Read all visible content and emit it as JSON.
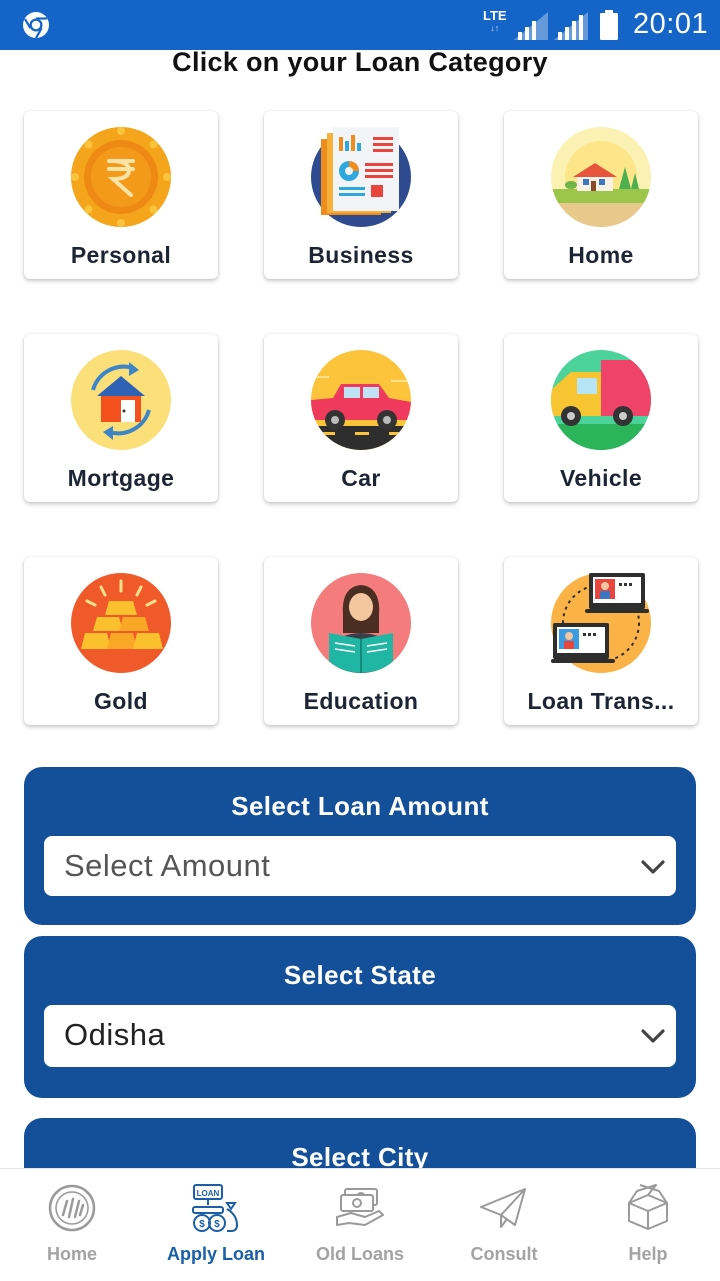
{
  "status_bar": {
    "network": "LTE",
    "time": "20:01"
  },
  "page": {
    "heading": "Click on your Loan Category"
  },
  "categories": [
    {
      "label": "Personal",
      "icon": "rupee-coin-icon"
    },
    {
      "label": "Business",
      "icon": "business-report-icon"
    },
    {
      "label": "Home",
      "icon": "house-icon"
    },
    {
      "label": "Mortgage",
      "icon": "mortgage-house-icon"
    },
    {
      "label": "Car",
      "icon": "car-icon"
    },
    {
      "label": "Vehicle",
      "icon": "truck-icon"
    },
    {
      "label": "Gold",
      "icon": "gold-bars-icon"
    },
    {
      "label": "Education",
      "icon": "student-reading-icon"
    },
    {
      "label": "Loan Trans...",
      "icon": "laptop-transfer-icon"
    }
  ],
  "loan_amount": {
    "title": "Select Loan Amount",
    "value": "Select Amount"
  },
  "state": {
    "title": "Select State",
    "value": "Odisha"
  },
  "city": {
    "title": "Select City"
  },
  "bottom_nav": [
    {
      "label": "Home",
      "icon": "home-coins-icon",
      "active": false
    },
    {
      "label": "Apply Loan",
      "icon": "loan-bag-icon",
      "active": true
    },
    {
      "label": "Old Loans",
      "icon": "money-hand-icon",
      "active": false
    },
    {
      "label": "Consult",
      "icon": "paper-plane-icon",
      "active": false
    },
    {
      "label": "Help",
      "icon": "help-box-icon",
      "active": false
    }
  ],
  "colors": {
    "status_bar": "#1565c8",
    "panel": "#14509a",
    "nav_active": "#1a5fa8",
    "nav_inactive": "#a3a3a3"
  }
}
